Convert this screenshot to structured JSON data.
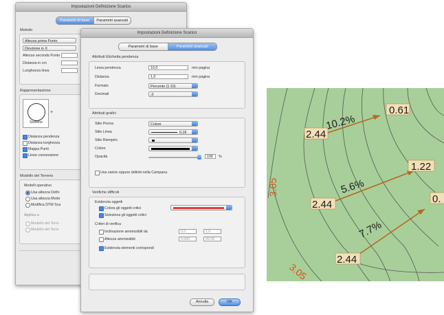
{
  "back_dialog": {
    "title": "Impostazioni Definizione Scarico",
    "tabs": [
      "Parametri di base",
      "Parametri avanzati"
    ],
    "metodo_header": "Metodo",
    "metodo_popup": "Altezza prima Punto",
    "metodo_popup2": "Direzione in X",
    "row_altezza_seconda": "Altezza seconda Punto",
    "row_distanza": "Distanza in cm",
    "row_lunghezza": "Lunghezza linea",
    "rappresentazione_header": "Rappresentazione",
    "preview_label": "Sezione",
    "checks": [
      "Distanza pendenza",
      "Distanza lunghezza",
      "Mappa Punti",
      "Linee connessione"
    ],
    "modello_header": "Modello del Terreno",
    "modelli_label": "Modelli operativo",
    "radios": [
      "Usa altezza Defin",
      "Usa altezza Mode",
      "Modifica DTM Sca"
    ],
    "applica_label": "Applica a",
    "applica_items": [
      "Modello del Terre",
      "Modello del Terre"
    ]
  },
  "front_dialog": {
    "title": "Impostazioni Definizione Scarico",
    "tabs": [
      "Parametri di base",
      "Parametri avanzati"
    ],
    "section_pendenza": "Attributi Etichetta pendenza",
    "linea_label": "Linea pendenza",
    "linea_value": "10,0",
    "linea_unit": "mm pagina",
    "distanza_label": "Distanza",
    "distanza_value": "1,0",
    "distanza_unit": "mm pagina",
    "formato_label": "Formato",
    "formato_value": "Percento (1:10)",
    "decimali_label": "Decimali",
    "decimali_value": ",0",
    "section_grafici": "Attributi grafici",
    "stile_penna_label": "Stile Penna",
    "stile_penna_value": "Colore",
    "stile_linea_label": "Stile Linea",
    "stile_linea_value": "0,18",
    "stile_riempimento_label": "Stile Riempim.",
    "colore_label": "Colore",
    "opacita_label": "Opacità",
    "opacita_value": "100",
    "opacita_unit": "%",
    "usa_valore_label": "Usa valore oppure definiti nella Campana",
    "section_verifica": "Verifiche difficoli",
    "evidenzia_label": "Evidenzia oggetti",
    "colora_label": "Colora gli oggetti critici",
    "seleziona_label": "Seleziona gli oggetti critici",
    "criteri_label": "Criteri di verifica",
    "inclinazione_label": "Inclinazione ammissibili da",
    "inclinazione_from": "0,0",
    "inclinazione_to": "1,0",
    "altezza_label": "Altezza ammissibili",
    "altezza_from": "0,000",
    "altezza_to": "99,00",
    "evidenzia_corr_label": "Evidenzia elementi corrispondi",
    "annulla": "Annulla",
    "ok": "OK",
    "highlight_color": "#e23b3b"
  },
  "map": {
    "background": "#a8cf9a",
    "contour_color": "#555555",
    "arrow_color": "#b3691f",
    "label_color": "#d6501d",
    "labels": {
      "slope1": "10.2%",
      "slope2": "5.6%",
      "slope3": "7.7%",
      "top1": "0.61",
      "top2": "1.22",
      "top3": "0.",
      "base1": "2.44",
      "base2": "2.44",
      "base3": "2.44",
      "contour_a": "3.05",
      "contour_b": "3.05"
    }
  }
}
